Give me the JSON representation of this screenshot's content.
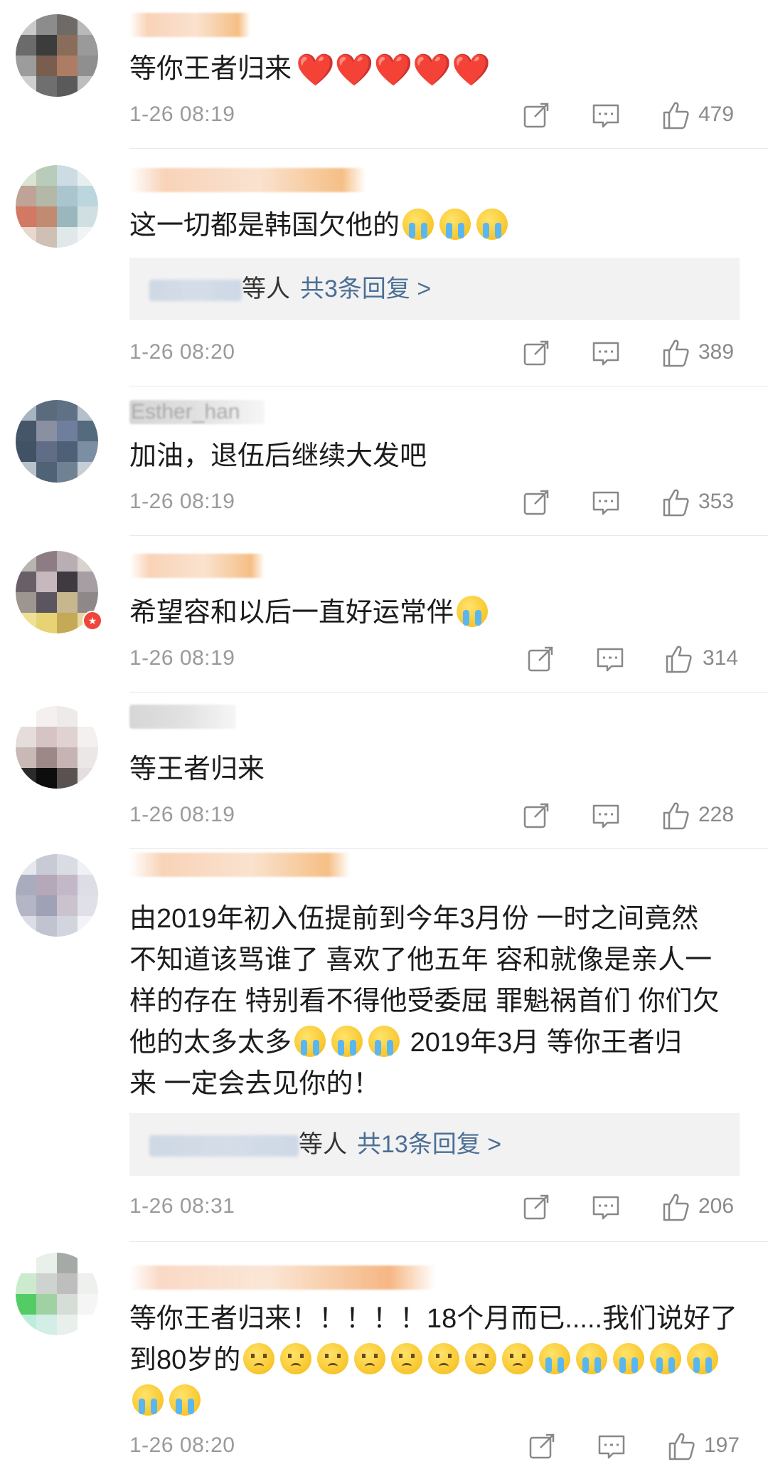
{
  "comments": [
    {
      "text": "等你王者归来",
      "hearts": "❤️❤️❤️❤️❤️",
      "time": "1-26 08:19",
      "likes": "479"
    },
    {
      "text": "这一切都是韩国欠他的",
      "time": "1-26 08:20",
      "likes": "389",
      "replies": {
        "suffix": "等人",
        "link": "共3条回复 >"
      }
    },
    {
      "username": "Esther_han",
      "text": "加油，退伍后继续大发吧",
      "time": "1-26 08:19",
      "likes": "353"
    },
    {
      "text": "希望容和以后一直好运常伴",
      "time": "1-26 08:19",
      "likes": "314"
    },
    {
      "text": "等王者归来",
      "time": "1-26 08:19",
      "likes": "228"
    },
    {
      "text": "由2019年初入伍提前到今年3月份 一时之间竟然\n不知道该骂谁了 喜欢了他五年 容和就像是亲人一\n样的存在 特别看不得他受委屈 罪魁祸首们 你们欠\n他的太多太多",
      "text_tail": " 2019年3月 等你王者归\n来 一定会去见你的！",
      "time": "1-26 08:31",
      "likes": "206",
      "replies": {
        "suffix": "等人",
        "link": "共13条回复 >"
      }
    },
    {
      "text": "等你王者归来！！！！！18个月而已.....我们说好了\n到80岁的",
      "time": "1-26 08:20",
      "likes": "197"
    }
  ],
  "icons": {
    "share": "share-icon",
    "comment": "comment-icon",
    "like": "like-icon"
  },
  "colors": {
    "link": "#4b6f96",
    "time": "#9a9a9a",
    "reply_bg": "#f2f2f2"
  }
}
